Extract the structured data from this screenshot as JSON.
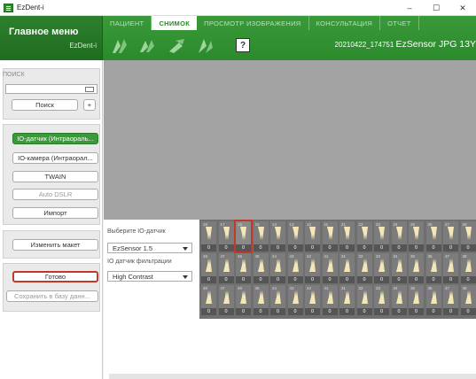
{
  "window": {
    "title": "EzDent-i",
    "minimize": "–",
    "maximize": "☐",
    "close": "✕"
  },
  "menu": {
    "title": "Главное меню",
    "subtitle": "EzDent-i"
  },
  "tabs": [
    {
      "label": "ПАЦИЕНТ",
      "active": false
    },
    {
      "label": "СНИМОК",
      "active": true
    },
    {
      "label": "ПРОСМОТР ИЗОБРАЖЕНИЯ",
      "active": false
    },
    {
      "label": "КОНСУЛЬТАЦИЯ",
      "active": false
    },
    {
      "label": "ОТЧЕТ",
      "active": false
    }
  ],
  "toolbar": {
    "help": "?",
    "image_id": "20210422_174751",
    "image_name": "EzSensor JPG 13Y"
  },
  "left": {
    "search_label": "ПОИСК",
    "search_button": "Поиск",
    "plus_button": "+",
    "sources": [
      "IO-датчик (Интраораль...",
      "IO-камера (Интраорал...",
      "TWAIN",
      "Auto DSLR",
      "Импорт"
    ],
    "change_layout": "Изменить макет",
    "done": "Готово",
    "save_db": "Сохранить в базу данн..."
  },
  "bottom": {
    "sensor_label": "Выберите IO-датчик",
    "sensor_value": "EzSensor 1.5",
    "filter_label": "IO датчик фильтрации",
    "filter_value": "High Contrast"
  },
  "teeth": {
    "row1": [
      "18",
      "17",
      "16",
      "15",
      "14",
      "13",
      "12",
      "11",
      "21",
      "22",
      "23",
      "24",
      "25",
      "26",
      "27",
      "28"
    ],
    "row2": [
      "48",
      "47",
      "46",
      "45",
      "44",
      "43",
      "42",
      "41",
      "31",
      "32",
      "33",
      "34",
      "35",
      "36",
      "37",
      "38"
    ],
    "row3": [
      "48",
      "47",
      "46",
      "45",
      "44",
      "43",
      "42",
      "41",
      "31",
      "32",
      "33",
      "34",
      "35",
      "36",
      "37",
      "38"
    ],
    "count": "0",
    "selected": "16"
  },
  "colors": {
    "green": "#3a9a3a",
    "dark_green": "#1f6d1f",
    "red": "#c0392b",
    "viewer": "#a3a3a3"
  }
}
